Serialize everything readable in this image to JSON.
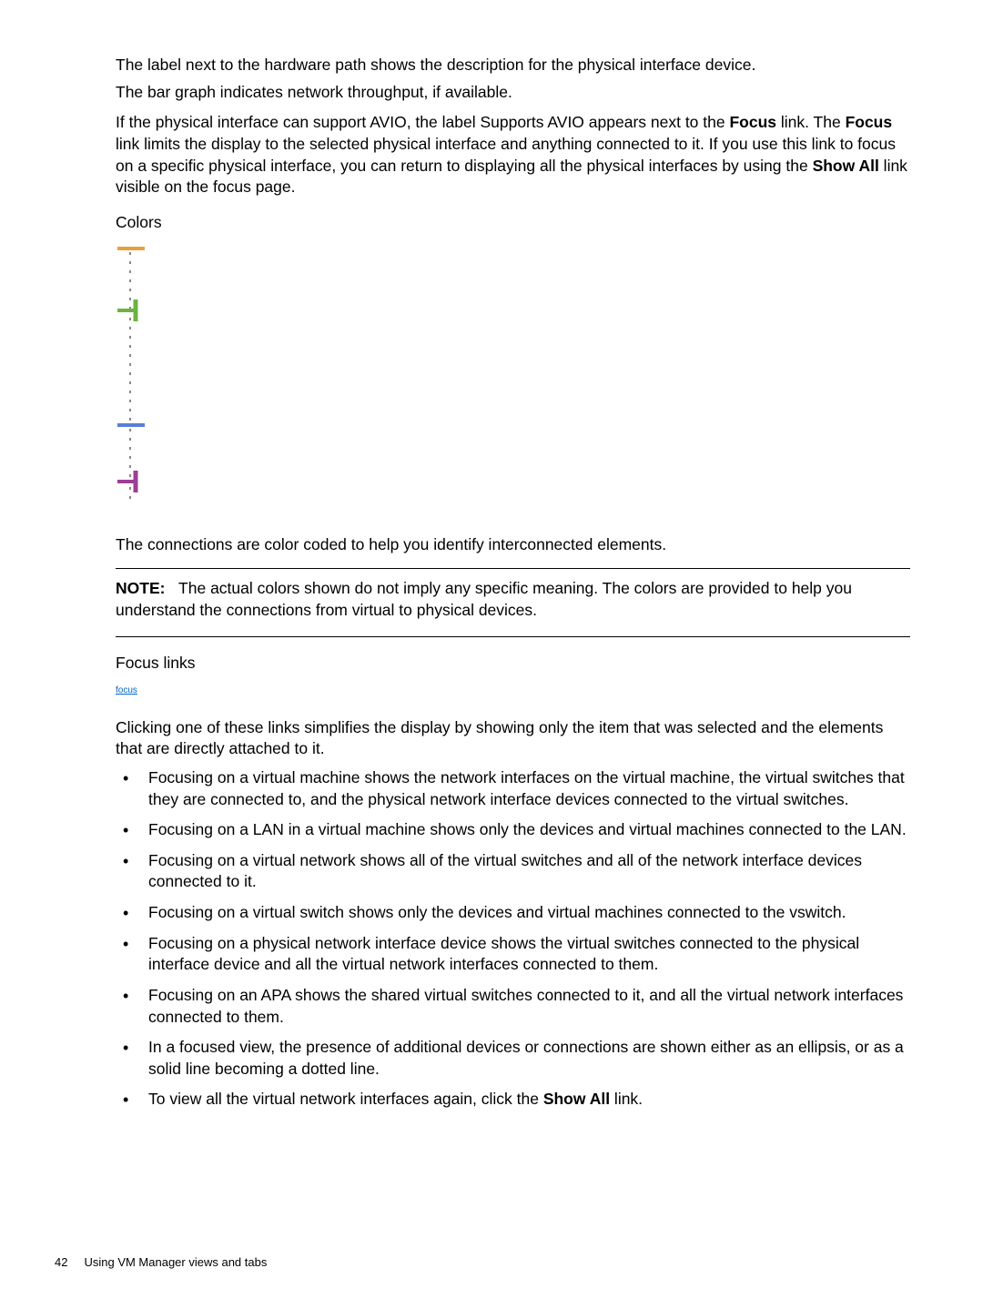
{
  "para1": "The label next to the hardware path shows the description for the physical interface device.",
  "para2": "The bar graph indicates network throughput, if available.",
  "para3_a": "If the physical interface can support AVIO, the label Supports AVIO appears next to the ",
  "para3_focus": "Focus",
  "para3_b": " link. The ",
  "para3_focus2": "Focus",
  "para3_c": " link limits the display to the selected physical interface and anything connected to it. If you use this link to focus on a specific physical interface, you can return to displaying all the physical interfaces by using the ",
  "para3_showall": "Show All",
  "para3_d": " link visible on the focus page.",
  "colors_heading": "Colors",
  "connections_para": "The connections are color coded to help you identify interconnected elements.",
  "note_label": "NOTE:",
  "note_text": "The actual colors shown do not imply any specific meaning. The colors are provided to help you understand the connections from virtual to physical devices.",
  "focus_links_heading": "Focus links",
  "focus_link_text": "focus",
  "clicking_para": "Clicking one of these links simplifies the display by showing only the item that was selected and the elements that are directly attached to it.",
  "bullets": [
    "Focusing on a virtual machine shows the network interfaces on the virtual machine, the virtual switches that they are connected to, and the physical network interface devices connected to the virtual switches.",
    "Focusing on a LAN in a virtual machine shows only the devices and virtual machines connected to the LAN.",
    "Focusing on a virtual network shows all of the virtual switches and all of the network interface devices connected to it.",
    "Focusing on a virtual switch shows only the devices and virtual machines connected to the vswitch.",
    "Focusing on a physical network interface device shows the virtual switches connected to the physical interface device and all the virtual network interfaces connected to them.",
    "Focusing on an APA shows the shared virtual switches connected to it, and all the virtual network interfaces connected to them.",
    "In a focused view, the presence of additional devices or connections are shown either as an ellipsis, or as a solid line becoming a dotted line."
  ],
  "last_bullet_a": "To view all the virtual network interfaces again, click the ",
  "last_bullet_bold": "Show All",
  "last_bullet_b": " link.",
  "page_number": "42",
  "footer_text": "Using VM Manager views and tabs"
}
